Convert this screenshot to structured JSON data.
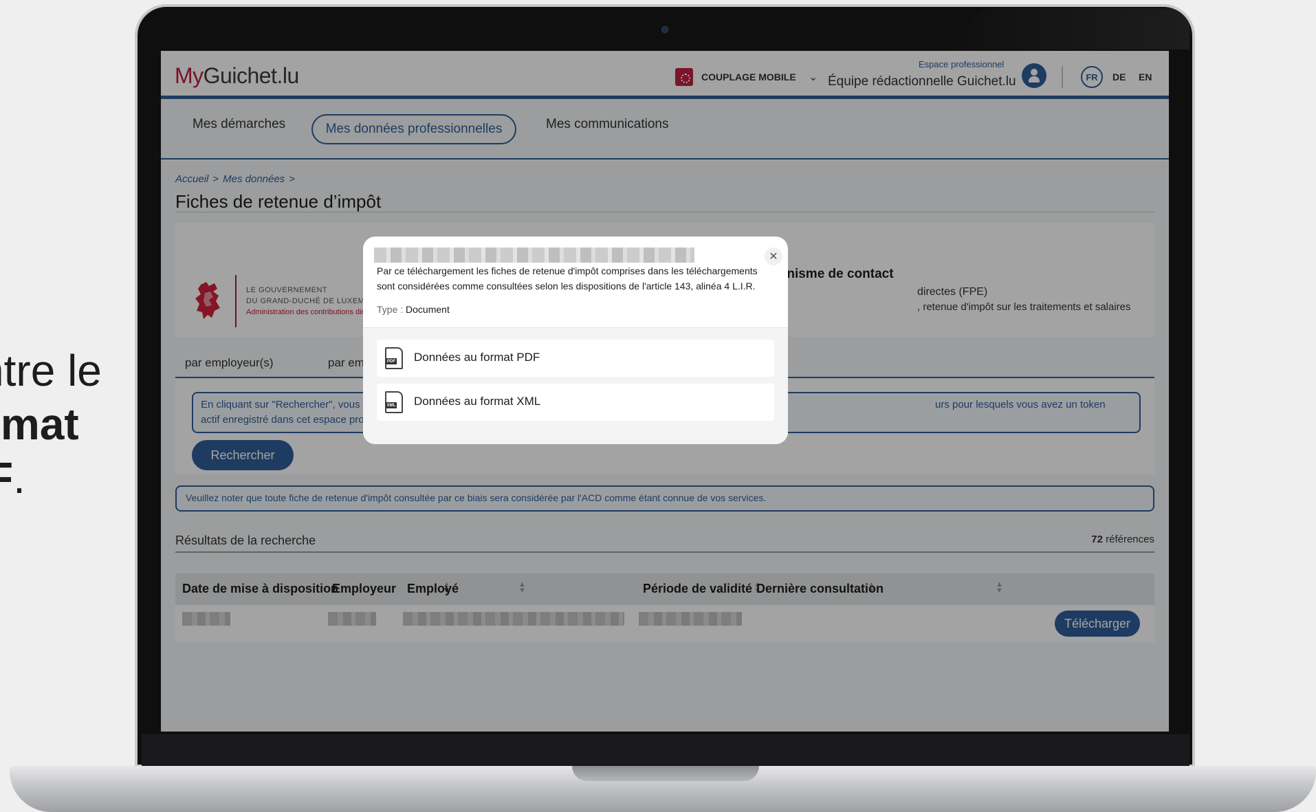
{
  "side_text": {
    "line1": "ntre le",
    "line2": "rmat",
    "line3_bold": "F",
    "line3_rest": "."
  },
  "header": {
    "logo_brand": "My",
    "logo_rest": "Guichet.lu",
    "couplage_label": "COUPLAGE MOBILE",
    "espace_label": "Espace professionnel",
    "user_name": "Équipe rédactionnelle Guichet.lu",
    "languages": [
      "FR",
      "DE",
      "EN"
    ],
    "active_language": "FR"
  },
  "nav": {
    "items": [
      "Mes démarches",
      "Mes données professionnelles",
      "Mes communications"
    ],
    "active": "Mes données professionnelles"
  },
  "breadcrumb": [
    "Accueil",
    "Mes données"
  ],
  "page_title": "Fiches de retenue d’impôt",
  "gov": {
    "line1": "LE GOUVERNEMENT",
    "line2": "DU GRAND-DUCHÉ DE LUXEMBOURG",
    "line3": "Administration des contributions directes"
  },
  "contact": {
    "title": "Organisme de contact",
    "line1": "directes (FPE)",
    "line2": ", retenue d'impôt sur les traitements et salaires"
  },
  "search_tabs": [
    "par employeur(s)",
    "par employé"
  ],
  "info": {
    "line1": "En cliquant sur \"Rechercher\", vous aurez",
    "line2": "actif enregistré dans cet espace professio",
    "line1_right": "urs pour lesquels vous avez un token"
  },
  "search_button": "Rechercher",
  "notice": "Veuillez noter que toute fiche de retenue d'impôt consultée par ce biais sera considérée par l'ACD comme étant connue de vos services.",
  "results": {
    "title": "Résultats de la recherche",
    "count": "72",
    "count_label": "références",
    "columns": [
      "Date de mise à disposition",
      "Employeur",
      "Employé",
      "Période de validité",
      "Dernière consultation"
    ],
    "row_button": "Télécharger"
  },
  "modal": {
    "line1": "Par ce téléchargement les fiches de retenue d'impôt comprises dans les téléchargements",
    "line2": "sont considérées comme consultées selon les dispositions de l'article 143, alinéa 4 L.I.R.",
    "type_key": "Type :",
    "type_value": "Document",
    "options": [
      {
        "label": "Données au format PDF",
        "icon": "pdf-file-icon",
        "tag": "PDF"
      },
      {
        "label": "Données au format XML",
        "icon": "xml-file-icon",
        "tag": "XML"
      }
    ]
  },
  "colors": {
    "brand_red": "#c01c3c",
    "brand_blue": "#2f5f98"
  }
}
